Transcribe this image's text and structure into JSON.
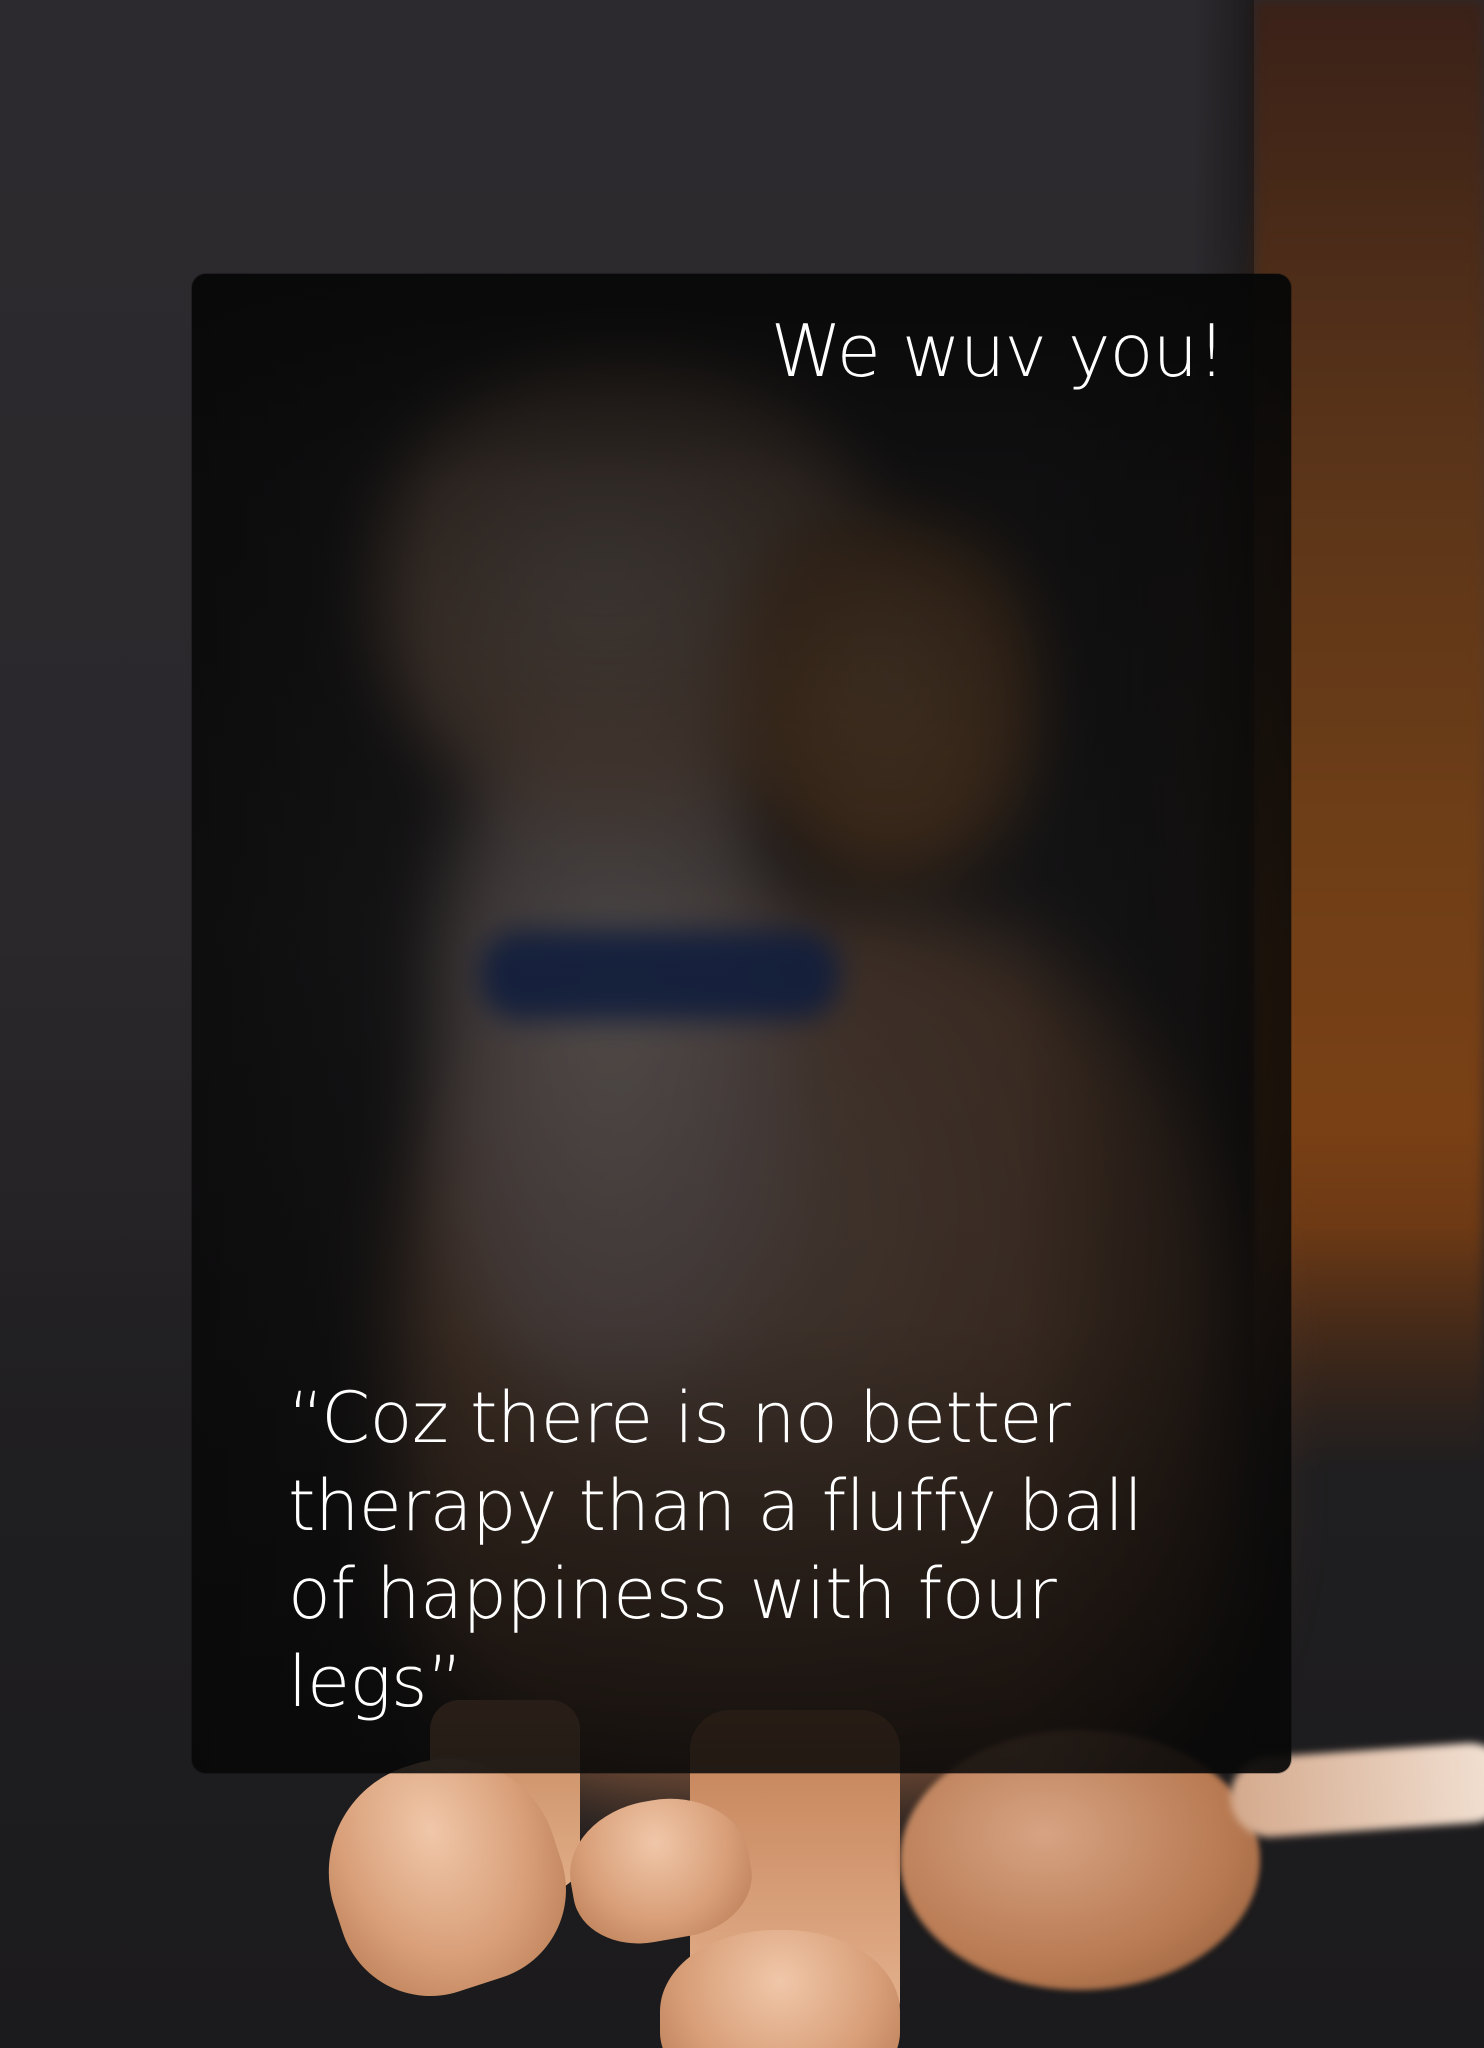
{
  "card": {
    "title": "We wuv you!",
    "quote": "“Coz there is no better therapy than a fluffy ball of happiness with four legs”"
  },
  "colors": {
    "background": "#2a282b",
    "card_overlay": "#0a0a0a",
    "text": "#ffffff",
    "collar": "#1d3f8f",
    "fur": "#d9a07a"
  }
}
